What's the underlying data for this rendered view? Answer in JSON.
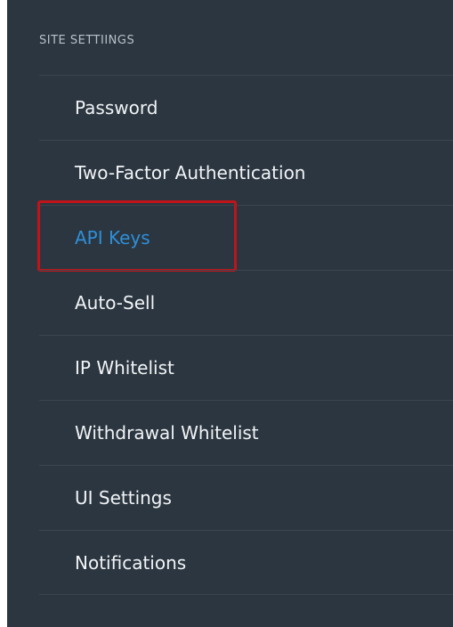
{
  "sidebar": {
    "title": "SITE SETTIINGS",
    "items": [
      {
        "label": "Password",
        "active": false
      },
      {
        "label": "Two-Factor Authentication",
        "active": false
      },
      {
        "label": "API Keys",
        "active": true
      },
      {
        "label": "Auto-Sell",
        "active": false
      },
      {
        "label": "IP Whitelist",
        "active": false
      },
      {
        "label": "Withdrawal Whitelist",
        "active": false
      },
      {
        "label": "UI Settings",
        "active": false
      },
      {
        "label": "Notifications",
        "active": false
      }
    ]
  },
  "colors": {
    "background": "#2b3640",
    "divider": "#3a4550",
    "text": "#f2f4f6",
    "active_text": "#2f8fd8",
    "highlight_border": "#c0141a"
  }
}
